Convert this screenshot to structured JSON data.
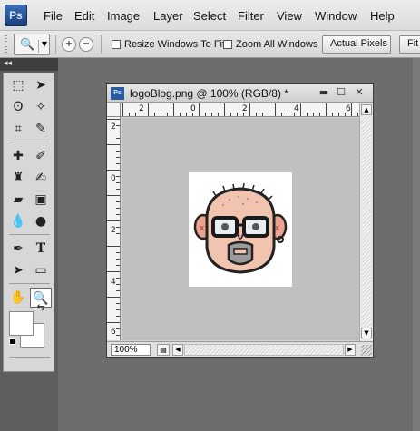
{
  "app": {
    "logo": "Ps"
  },
  "menu": {
    "items": [
      "File",
      "Edit",
      "Image",
      "Layer",
      "Select",
      "Filter",
      "View",
      "Window",
      "Help"
    ]
  },
  "options": {
    "resize_windows_label": "Resize Windows To Fit",
    "zoom_all_label": "Zoom All Windows",
    "actual_pixels_label": "Actual Pixels",
    "fit_screen_label": "Fit S"
  },
  "tools_panel": {
    "collapse_glyph": "◂◂"
  },
  "document": {
    "title": "logoBlog.png @ 100% (RGB/8) *",
    "zoom": "100%",
    "ruler_top": [
      "2",
      "0",
      "2",
      "4",
      "6"
    ],
    "ruler_left": [
      "2",
      "0",
      "2",
      "4",
      "6"
    ]
  },
  "colors": {
    "workspace": "#6d6d6d",
    "canvas_bg": "#c0c0c0",
    "ps_blue": "#2a5aa0"
  },
  "icons": {
    "zoom_tool": "magnifier-icon",
    "zoom_in": "zoom-in-icon",
    "zoom_out": "zoom-out-icon"
  }
}
